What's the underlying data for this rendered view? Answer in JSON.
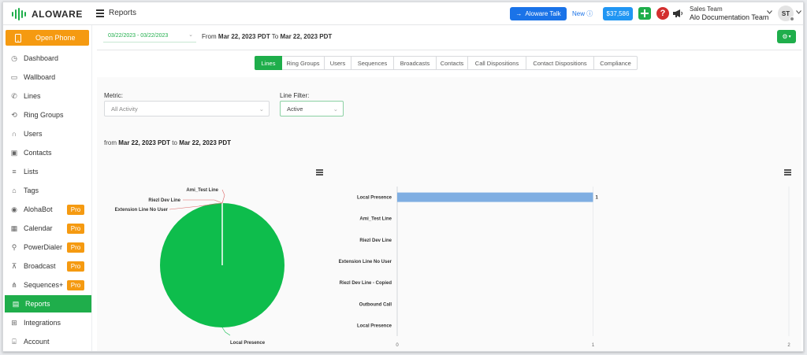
{
  "header": {
    "brand": "ALOWARE",
    "page_title": "Reports",
    "talk_button": "Aloware Talk",
    "new_label": "New",
    "balance": "$37,586",
    "help_symbol": "?",
    "team_label": "Sales Team",
    "team_name": "Alo Documentation Team",
    "avatar_initials": "ST"
  },
  "sidebar": {
    "open_phone": "Open Phone",
    "items": [
      {
        "label": "Dashboard",
        "icon": "dashboard-icon"
      },
      {
        "label": "Wallboard",
        "icon": "monitor-icon"
      },
      {
        "label": "Lines",
        "icon": "phone-icon"
      },
      {
        "label": "Ring Groups",
        "icon": "ring-groups-icon"
      },
      {
        "label": "Users",
        "icon": "headset-icon"
      },
      {
        "label": "Contacts",
        "icon": "contact-card-icon"
      },
      {
        "label": "Lists",
        "icon": "list-icon"
      },
      {
        "label": "Tags",
        "icon": "tag-icon"
      },
      {
        "label": "AlohaBot",
        "icon": "bot-icon",
        "badge": "Pro"
      },
      {
        "label": "Calendar",
        "icon": "calendar-icon",
        "badge": "Pro"
      },
      {
        "label": "PowerDialer",
        "icon": "power-dialer-icon",
        "badge": "Pro"
      },
      {
        "label": "Broadcast",
        "icon": "broadcast-icon",
        "badge": "Pro"
      },
      {
        "label": "Sequences+",
        "icon": "sequences-icon",
        "badge": "Pro"
      },
      {
        "label": "Reports",
        "icon": "reports-icon",
        "active": true
      },
      {
        "label": "Integrations",
        "icon": "integrations-icon"
      },
      {
        "label": "Account",
        "icon": "account-icon"
      }
    ]
  },
  "filter": {
    "date_range": "03/22/2023 - 03/22/2023",
    "from_prefix": "From",
    "from_date": "Mar 22, 2023 PDT",
    "to_word": "To",
    "to_date": "Mar 22, 2023 PDT"
  },
  "tabs": [
    {
      "label": "Lines",
      "active": true
    },
    {
      "label": "Ring Groups"
    },
    {
      "label": "Users"
    },
    {
      "label": "Sequences"
    },
    {
      "label": "Broadcasts"
    },
    {
      "label": "Contacts"
    },
    {
      "label": "Call Dispositions"
    },
    {
      "label": "Contact Dispositions"
    },
    {
      "label": "Compliance"
    }
  ],
  "controls": {
    "metric_label": "Metric:",
    "metric_value": "All Activity",
    "line_filter_label": "Line Filter:",
    "line_filter_value": "Active"
  },
  "summary": {
    "from_word": "from",
    "from_date": "Mar 22, 2023 PDT",
    "to_word": "to",
    "to_date": "Mar 22, 2023 PDT"
  },
  "colors": {
    "accent_green": "#1fae4b",
    "orange": "#f59a11",
    "blue": "#1a73e8",
    "pie_green": "#0ebd4c",
    "bar_blue": "#7faee2"
  },
  "chart_data": [
    {
      "type": "pie",
      "labels": [
        "Local Presence",
        "Ami_Test Line",
        "Riezl Dev Line",
        "Extension Line No User"
      ],
      "values": [
        1,
        0,
        0,
        0
      ]
    },
    {
      "type": "bar",
      "orientation": "horizontal",
      "categories": [
        "Local Presence",
        "Ami_Test Line",
        "Riezl Dev Line",
        "Extension Line No User",
        "Riezl Dev Line - Copied",
        "Outbound Call",
        "Local Presence"
      ],
      "values": [
        1,
        0,
        0,
        0,
        0,
        0,
        0
      ],
      "data_labels": [
        "1",
        "",
        "",
        "",
        "",
        "",
        ""
      ],
      "xticks": [
        "0",
        "1",
        "2"
      ],
      "xlim": [
        0,
        2
      ]
    }
  ]
}
